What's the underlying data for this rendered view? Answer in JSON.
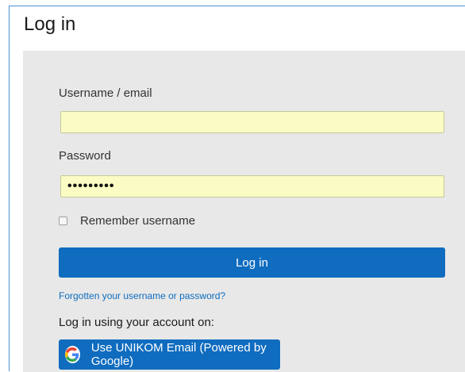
{
  "page": {
    "title": "Log in"
  },
  "form": {
    "username_label": "Username / email",
    "username_value": "",
    "password_label": "Password",
    "password_value": "•••••••••",
    "remember_label": "Remember username",
    "remember_checked": false,
    "login_button": "Log in",
    "forgot_link": "Forgotten your username or password?",
    "alt_login_label": "Log in using your account on:",
    "google_button": "Use UNIKOM Email (Powered by Google)"
  },
  "colors": {
    "primary": "#0f6cbf",
    "input_autofill": "#fafcc4",
    "panel_bg": "#e8e8e8",
    "frame_border": "#4a90d9"
  },
  "icons": {
    "google": "google-icon"
  }
}
